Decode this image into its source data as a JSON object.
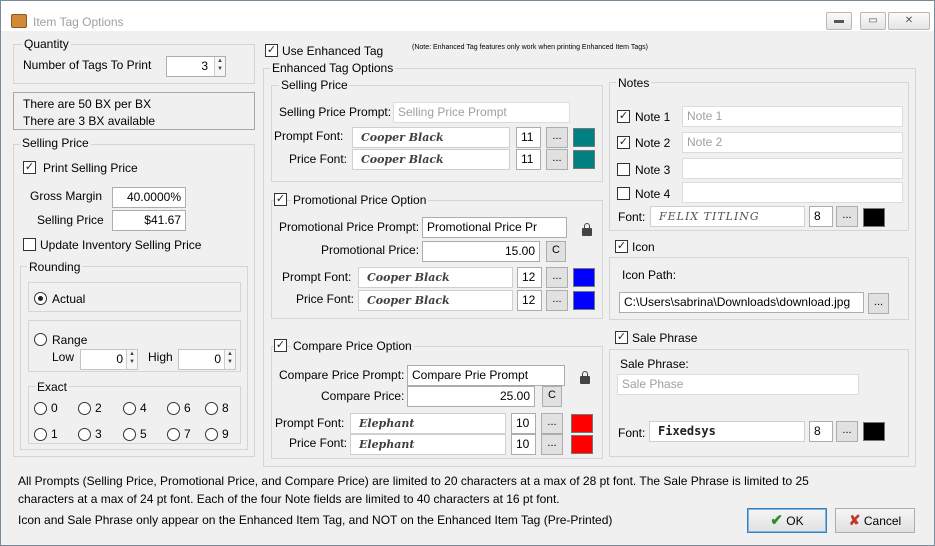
{
  "window": {
    "title": "Item Tag Options"
  },
  "quantity": {
    "label": "Quantity",
    "tags_label": "Number of Tags To Print",
    "tags_value": "3"
  },
  "info": {
    "line1": "There are 50 BX per BX",
    "line2": "There are 3 BX available"
  },
  "selling": {
    "group": "Selling Price",
    "print_label": "Print Selling Price",
    "print_checked": true,
    "margin_label": "Gross Margin",
    "margin_value": "40.0000%",
    "price_label": "Selling Price",
    "price_value": "$41.67",
    "update_label": "Update Inventory Selling Price",
    "update_checked": false
  },
  "rounding": {
    "label": "Rounding",
    "actual": "Actual",
    "range": "Range",
    "low": "Low",
    "low_value": "0",
    "high": "High",
    "high_value": "0",
    "exact": "Exact",
    "digits": [
      "0",
      "2",
      "4",
      "6",
      "8",
      "1",
      "3",
      "5",
      "7",
      "9"
    ]
  },
  "enhanced": {
    "use_label": "Use Enhanced Tag",
    "use_checked": true,
    "note": "(Note: Enhanced Tag features only work when printing Enhanced Item Tags)",
    "options_label": "Enhanced Tag Options"
  },
  "sp": {
    "group": "Selling Price",
    "prompt_label": "Selling Price Prompt:",
    "prompt_placeholder": "Selling Price Prompt",
    "prompt_font_label": "Prompt Font:",
    "prompt_font": "Cooper Black",
    "prompt_size": "11",
    "price_font_label": "Price Font:",
    "price_font": "Cooper Black",
    "price_size": "11"
  },
  "promo": {
    "group": "Promotional Price Option",
    "checked": true,
    "prompt_label": "Promotional Price Prompt:",
    "prompt_value": "Promotional Price Pr",
    "price_label": "Promotional Price:",
    "price_value": "15.00",
    "prompt_font_label": "Prompt Font:",
    "prompt_font": "Cooper Black",
    "prompt_size": "12",
    "price_font_label": "Price Font:",
    "price_font": "Cooper Black",
    "price_size": "12"
  },
  "compare": {
    "group": "Compare Price Option",
    "checked": true,
    "prompt_label": "Compare Price Prompt:",
    "prompt_value": "Compare Prie Prompt",
    "price_label": "Compare Price:",
    "price_value": "25.00",
    "prompt_font_label": "Prompt Font:",
    "prompt_font": "Elephant",
    "prompt_size": "10",
    "price_font_label": "Price Font:",
    "price_font": "Elephant",
    "price_size": "10"
  },
  "notes": {
    "group": "Notes",
    "items": [
      {
        "label": "Note 1",
        "checked": true,
        "placeholder": "Note 1"
      },
      {
        "label": "Note 2",
        "checked": true,
        "placeholder": "Note 2"
      },
      {
        "label": "Note 3",
        "checked": false,
        "placeholder": ""
      },
      {
        "label": "Note 4",
        "checked": false,
        "placeholder": ""
      }
    ],
    "font_label": "Font:",
    "font": "FELIX TITLING",
    "size": "8"
  },
  "icon": {
    "group": "Icon",
    "checked": true,
    "path_label": "Icon Path:",
    "path_value": "C:\\Users\\sabrina\\Downloads\\download.jpg"
  },
  "phrase": {
    "group": "Sale Phrase",
    "checked": true,
    "label": "Sale Phrase:",
    "placeholder": "Sale Phase",
    "font_label": "Font:",
    "font": "Fixedsys",
    "size": "8"
  },
  "common": {
    "ellipsis": "...",
    "c": "C"
  },
  "footer": {
    "line1": "All Prompts (Selling Price, Promotional Price, and Compare Price) are limited to 20 characters at a max of 28 pt font. The Sale Phrase is limited to 25",
    "line2": "characters at a max of 24 pt font. Each of the four Note fields are limited to 40 characters at 16 pt font.",
    "line3": "Icon and Sale Phrase only appear on the Enhanced Item Tag, and NOT on the Enhanced Item Tag (Pre-Printed)"
  },
  "buttons": {
    "ok": "OK",
    "cancel": "Cancel"
  },
  "colors": {
    "teal": "#008080",
    "blue": "#0000ff",
    "red": "#ff0000",
    "black": "#000000",
    "ok_icon": "#2e8b2e",
    "cancel_icon": "#c0392b"
  }
}
